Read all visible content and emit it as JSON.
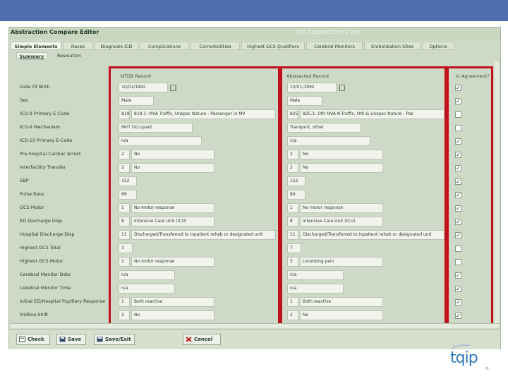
{
  "app": {
    "left_title": "Abstraction Compare Editor",
    "right_title": "ACS Abstract Entry Tool"
  },
  "tabs": [
    {
      "label": "Simple Elements",
      "active": true
    },
    {
      "label": "Races",
      "active": false
    },
    {
      "label": "Diagnosis ICD",
      "active": false
    },
    {
      "label": "Complications",
      "active": false
    },
    {
      "label": "Comorbidities",
      "active": false
    },
    {
      "label": "Highest GCS Qualifiers",
      "active": false
    },
    {
      "label": "Cerebral Monitors",
      "active": false
    },
    {
      "label": "Embolization Sites",
      "active": false
    },
    {
      "label": "Options",
      "active": false
    }
  ],
  "subtabs": [
    {
      "label": "Summary",
      "active": true
    },
    {
      "label": "Resolution",
      "active": false
    }
  ],
  "columns": {
    "col1": "NTDB Record",
    "col2": "Abstracted Record",
    "col3": "In Agreement?"
  },
  "rows": [
    {
      "label": "Date Of Birth",
      "a_code": "",
      "a_text": "10/01/1992",
      "b_code": "",
      "b_text": "10/01/1992",
      "agree": true
    },
    {
      "label": "Sex",
      "a_code": "",
      "a_text": "Male",
      "b_code": "",
      "b_text": "Male",
      "agree": true
    },
    {
      "label": "ICD-9 Primary E-Code",
      "a_code": "819.1",
      "a_text": "819.1: MVA Traffic, Unspec Nature - Passenger in MV",
      "b_code": "825.1",
      "b_text": "825.1: Oth MVA N-Traffic, Oth & Unspec Nature - Pas",
      "agree": false
    },
    {
      "label": "ICD-9 Mechanism",
      "a_code": "",
      "a_text": "MVT Occupant",
      "b_code": "",
      "b_text": "Transport, other",
      "agree": false
    },
    {
      "label": "ICD-10 Primary E-Code",
      "a_code": "",
      "a_text": "n/a",
      "b_code": "",
      "b_text": "n/a",
      "agree": true
    },
    {
      "label": "Pre-hospital Cardiac Arrest",
      "a_code": "2",
      "a_text": "No",
      "b_code": "2",
      "b_text": "No",
      "agree": true
    },
    {
      "label": "Interfacility Transfer",
      "a_code": "2",
      "a_text": "No",
      "b_code": "2",
      "b_text": "No",
      "agree": true
    },
    {
      "label": "SBP",
      "a_code": "",
      "a_text": "152",
      "b_code": "",
      "b_text": "152",
      "agree": true
    },
    {
      "label": "Pulse Rate",
      "a_code": "",
      "a_text": "89",
      "b_code": "",
      "b_text": "89",
      "agree": true
    },
    {
      "label": "GCS Motor",
      "a_code": "1",
      "a_text": "No motor response",
      "b_code": "1",
      "b_text": "No motor response",
      "agree": true
    },
    {
      "label": "ED Discharge Disp",
      "a_code": "8",
      "a_text": "Intensive Care Unit (ICU)",
      "b_code": "8",
      "b_text": "Intensive Care Unit (ICU)",
      "agree": true
    },
    {
      "label": "Hospital Discharge Disp",
      "a_code": "11",
      "a_text": "Discharged/Transferred to inpatient rehab or designated unit",
      "b_code": "11",
      "b_text": "Discharged/Transferred to inpatient rehab or designated unit",
      "agree": true
    },
    {
      "label": "Highest GCS Total",
      "a_code": "",
      "a_text": "3",
      "b_code": "",
      "b_text": "7",
      "agree": false
    },
    {
      "label": "Highest GCS Motor",
      "a_code": "1",
      "a_text": "No motor response",
      "b_code": "5",
      "b_text": "Localizing pain",
      "agree": false
    },
    {
      "label": "Cerebral Monitor Date",
      "a_code": "",
      "a_text": "n/a",
      "b_code": "",
      "b_text": "n/a",
      "agree": true
    },
    {
      "label": "Cerebral Monitor Time",
      "a_code": "",
      "a_text": "n/a",
      "b_code": "",
      "b_text": "n/a",
      "agree": true
    },
    {
      "label": "Initial ED/Hospital Pupillary Response",
      "a_code": "1",
      "a_text": "Both reactive",
      "b_code": "1",
      "b_text": "Both reactive",
      "agree": true
    },
    {
      "label": "Midline Shift",
      "a_code": "2",
      "a_text": "No",
      "b_code": "2",
      "b_text": "No",
      "agree": true
    }
  ],
  "buttons": {
    "check": "Check",
    "save": "Save",
    "save_exit": "Save/Exit",
    "cancel": "Cancel"
  },
  "logo": {
    "text": "tqip",
    "mark": "®"
  },
  "colors": {
    "banner": "#4f6fb0",
    "panel": "#cfd9c8",
    "highlight": "#c0111b",
    "logo": "#2e78b8"
  }
}
